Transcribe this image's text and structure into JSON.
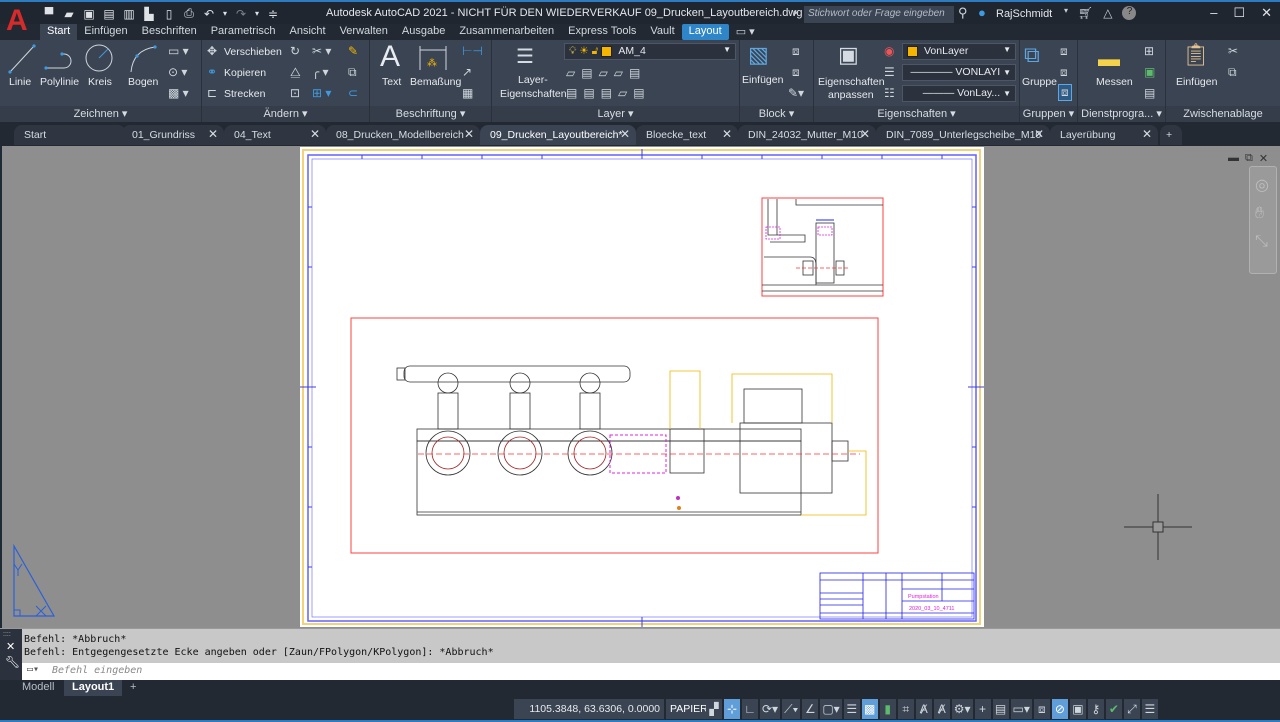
{
  "app": {
    "title": "Autodesk AutoCAD 2021 - NICHT FÜR DEN WIEDERVERKAUF   09_Drucken_Layoutbereich.dwg",
    "logo": "A",
    "search_placeholder": "Stichwort oder Frage eingeben",
    "username": "RajSchmidt",
    "quick_access": [
      "new-icon",
      "open-icon",
      "saveas-web-icon",
      "save-icon",
      "saveas-icon",
      "plot-preview-icon",
      "share-icon",
      "print-icon",
      "undo-icon",
      "redo-icon",
      "customize-icon"
    ]
  },
  "ribbon_tabs": [
    "Start",
    "Einfügen",
    "Beschriften",
    "Parametrisch",
    "Ansicht",
    "Verwalten",
    "Ausgabe",
    "Zusammenarbeiten",
    "Express Tools",
    "Vault",
    "Layout"
  ],
  "ribbon": {
    "zeichnen": {
      "title": "Zeichnen",
      "linie": "Linie",
      "polylinie": "Polylinie",
      "kreis": "Kreis",
      "bogen": "Bogen"
    },
    "aendern": {
      "title": "Ändern",
      "verschieben": "Verschieben",
      "kopieren": "Kopieren",
      "strecken": "Strecken"
    },
    "beschriftung": {
      "title": "Beschriftung",
      "text": "Text",
      "bemassung": "Bemaßung"
    },
    "layer": {
      "title": "Layer",
      "props_line1": "Layer-",
      "props_line2": "Eigenschaften",
      "current": "AM_4"
    },
    "block": {
      "title": "Block",
      "einfuegen": "Einfügen"
    },
    "eigenschaften": {
      "title": "Eigenschaften",
      "anpassen_line1": "Eigenschaften",
      "anpassen_line2": "anpassen",
      "color": "VonLayer",
      "lineweight": "VONLAYI",
      "linetype": "VonLay..."
    },
    "gruppen": {
      "title": "Gruppen",
      "gruppe": "Gruppe"
    },
    "dienstprogramme": {
      "title": "Dienstprogra...",
      "messen": "Messen"
    },
    "zwischenablage": {
      "title": "Zwischenablage",
      "einfuegen": "Einfügen"
    }
  },
  "doc_tabs": [
    {
      "label": "Start",
      "closable": false
    },
    {
      "label": "01_Grundriss",
      "closable": true
    },
    {
      "label": "04_Text",
      "closable": true
    },
    {
      "label": "08_Drucken_Modellbereich",
      "closable": true
    },
    {
      "label": "09_Drucken_Layoutbereich*",
      "closable": true,
      "active": true
    },
    {
      "label": "Bloecke_text",
      "closable": true
    },
    {
      "label": "DIN_24032_Mutter_M10",
      "closable": true
    },
    {
      "label": "DIN_7089_Unterlegscheibe_M10",
      "closable": true
    },
    {
      "label": "Layerübung",
      "closable": true
    }
  ],
  "drawing": {
    "title_block": {
      "name": "Pumpstation",
      "number": "2020_03_10_4711"
    }
  },
  "command": {
    "history": [
      "Befehl: *Abbruch*",
      "Befehl: Entgegengesetzte Ecke angeben oder [Zaun/FPolygon/KPolygon]: *Abbruch*"
    ],
    "placeholder": "Befehl eingeben"
  },
  "layout_tabs": [
    {
      "label": "Modell"
    },
    {
      "label": "Layout1",
      "active": true
    }
  ],
  "status": {
    "coordinates": "1105.3848, 63.6306, 0.0000",
    "space": "PAPIER"
  },
  "colors": {
    "accent": "#2e86c9",
    "layer_color": "#f5b400",
    "paper": "#ffffff",
    "viewport_bg": "#8e8e8e"
  }
}
